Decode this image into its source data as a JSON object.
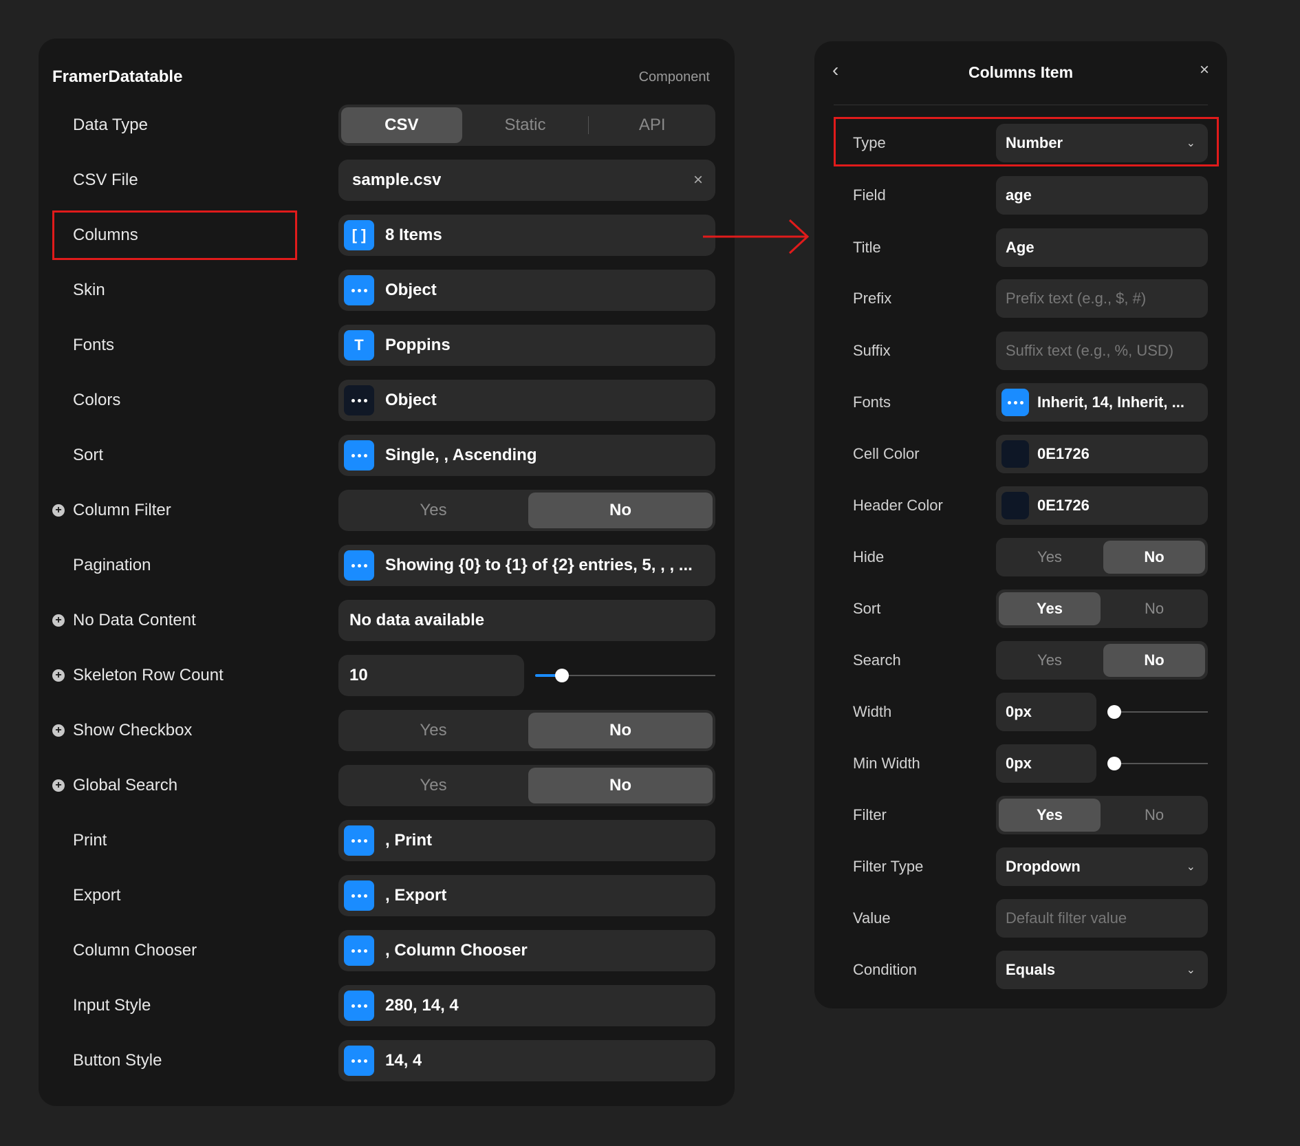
{
  "left_panel": {
    "title": "FramerDatatable",
    "subtitle": "Component",
    "data_type": {
      "label": "Data Type",
      "options": [
        "CSV",
        "Static",
        "API"
      ],
      "selected": "CSV"
    },
    "csv_file": {
      "label": "CSV File",
      "value": "sample.csv",
      "clear_icon": "×"
    },
    "columns": {
      "label": "Columns",
      "value": "8 Items",
      "icon": "array-icon",
      "icon_glyph": "[ ]"
    },
    "skin": {
      "label": "Skin",
      "value": "Object",
      "icon": "more-dots-icon"
    },
    "fonts": {
      "label": "Fonts",
      "value": "Poppins",
      "icon": "text-icon",
      "icon_glyph": "T"
    },
    "colors": {
      "label": "Colors",
      "value": "Object",
      "icon": "more-dots-icon"
    },
    "sort": {
      "label": "Sort",
      "value": "Single, , Ascending",
      "icon": "more-dots-icon"
    },
    "column_filter": {
      "label": "Column Filter",
      "yes": "Yes",
      "no": "No",
      "selected": "No"
    },
    "pagination": {
      "label": "Pagination",
      "value": "Showing {0} to {1} of {2} entries, 5, , , ...",
      "icon": "more-dots-icon"
    },
    "no_data_content": {
      "label": "No Data Content",
      "value": "No data available"
    },
    "skeleton_row_count": {
      "label": "Skeleton Row Count",
      "value": "10",
      "slider_fraction": 0.12
    },
    "show_checkbox": {
      "label": "Show Checkbox",
      "yes": "Yes",
      "no": "No",
      "selected": "No"
    },
    "global_search": {
      "label": "Global Search",
      "yes": "Yes",
      "no": "No",
      "selected": "No"
    },
    "print": {
      "label": "Print",
      "value": ", Print",
      "icon": "more-dots-icon"
    },
    "export": {
      "label": "Export",
      "value": ", Export",
      "icon": "more-dots-icon"
    },
    "column_chooser": {
      "label": "Column Chooser",
      "value": ", Column Chooser",
      "icon": "more-dots-icon"
    },
    "input_style": {
      "label": "Input Style",
      "value": "280, 14, 4",
      "icon": "more-dots-icon"
    },
    "button_style": {
      "label": "Button Style",
      "value": "14, 4",
      "icon": "more-dots-icon"
    }
  },
  "right_panel": {
    "title": "Columns Item",
    "back_icon": "‹",
    "close_icon": "×",
    "type": {
      "label": "Type",
      "value": "Number"
    },
    "field": {
      "label": "Field",
      "value": "age"
    },
    "title_field": {
      "label": "Title",
      "value": "Age"
    },
    "prefix": {
      "label": "Prefix",
      "placeholder": "Prefix text (e.g., $, #)"
    },
    "suffix": {
      "label": "Suffix",
      "placeholder": "Suffix text (e.g., %, USD)"
    },
    "fonts": {
      "label": "Fonts",
      "value": "Inherit, 14, Inherit, ..."
    },
    "cell_color": {
      "label": "Cell Color",
      "value": "0E1726",
      "color": "#0E1726"
    },
    "header_color": {
      "label": "Header Color",
      "value": "0E1726",
      "color": "#0E1726"
    },
    "hide": {
      "label": "Hide",
      "yes": "Yes",
      "no": "No",
      "selected": "No"
    },
    "sort": {
      "label": "Sort",
      "yes": "Yes",
      "no": "No",
      "selected": "Yes"
    },
    "search": {
      "label": "Search",
      "yes": "Yes",
      "no": "No",
      "selected": "No"
    },
    "width": {
      "label": "Width",
      "value": "0px",
      "slider_fraction": 0
    },
    "min_width": {
      "label": "Min Width",
      "value": "0px",
      "slider_fraction": 0
    },
    "filter": {
      "label": "Filter",
      "yes": "Yes",
      "no": "No",
      "selected": "Yes"
    },
    "filter_type": {
      "label": "Filter Type",
      "value": "Dropdown"
    },
    "filter_value": {
      "label": "Value",
      "placeholder": "Default filter value"
    },
    "condition": {
      "label": "Condition",
      "value": "Equals"
    }
  },
  "colors": {
    "accent": "#1a8cff",
    "highlight": "#e01b1b",
    "panel_bg": "#171717",
    "control_bg": "#2b2b2b"
  }
}
